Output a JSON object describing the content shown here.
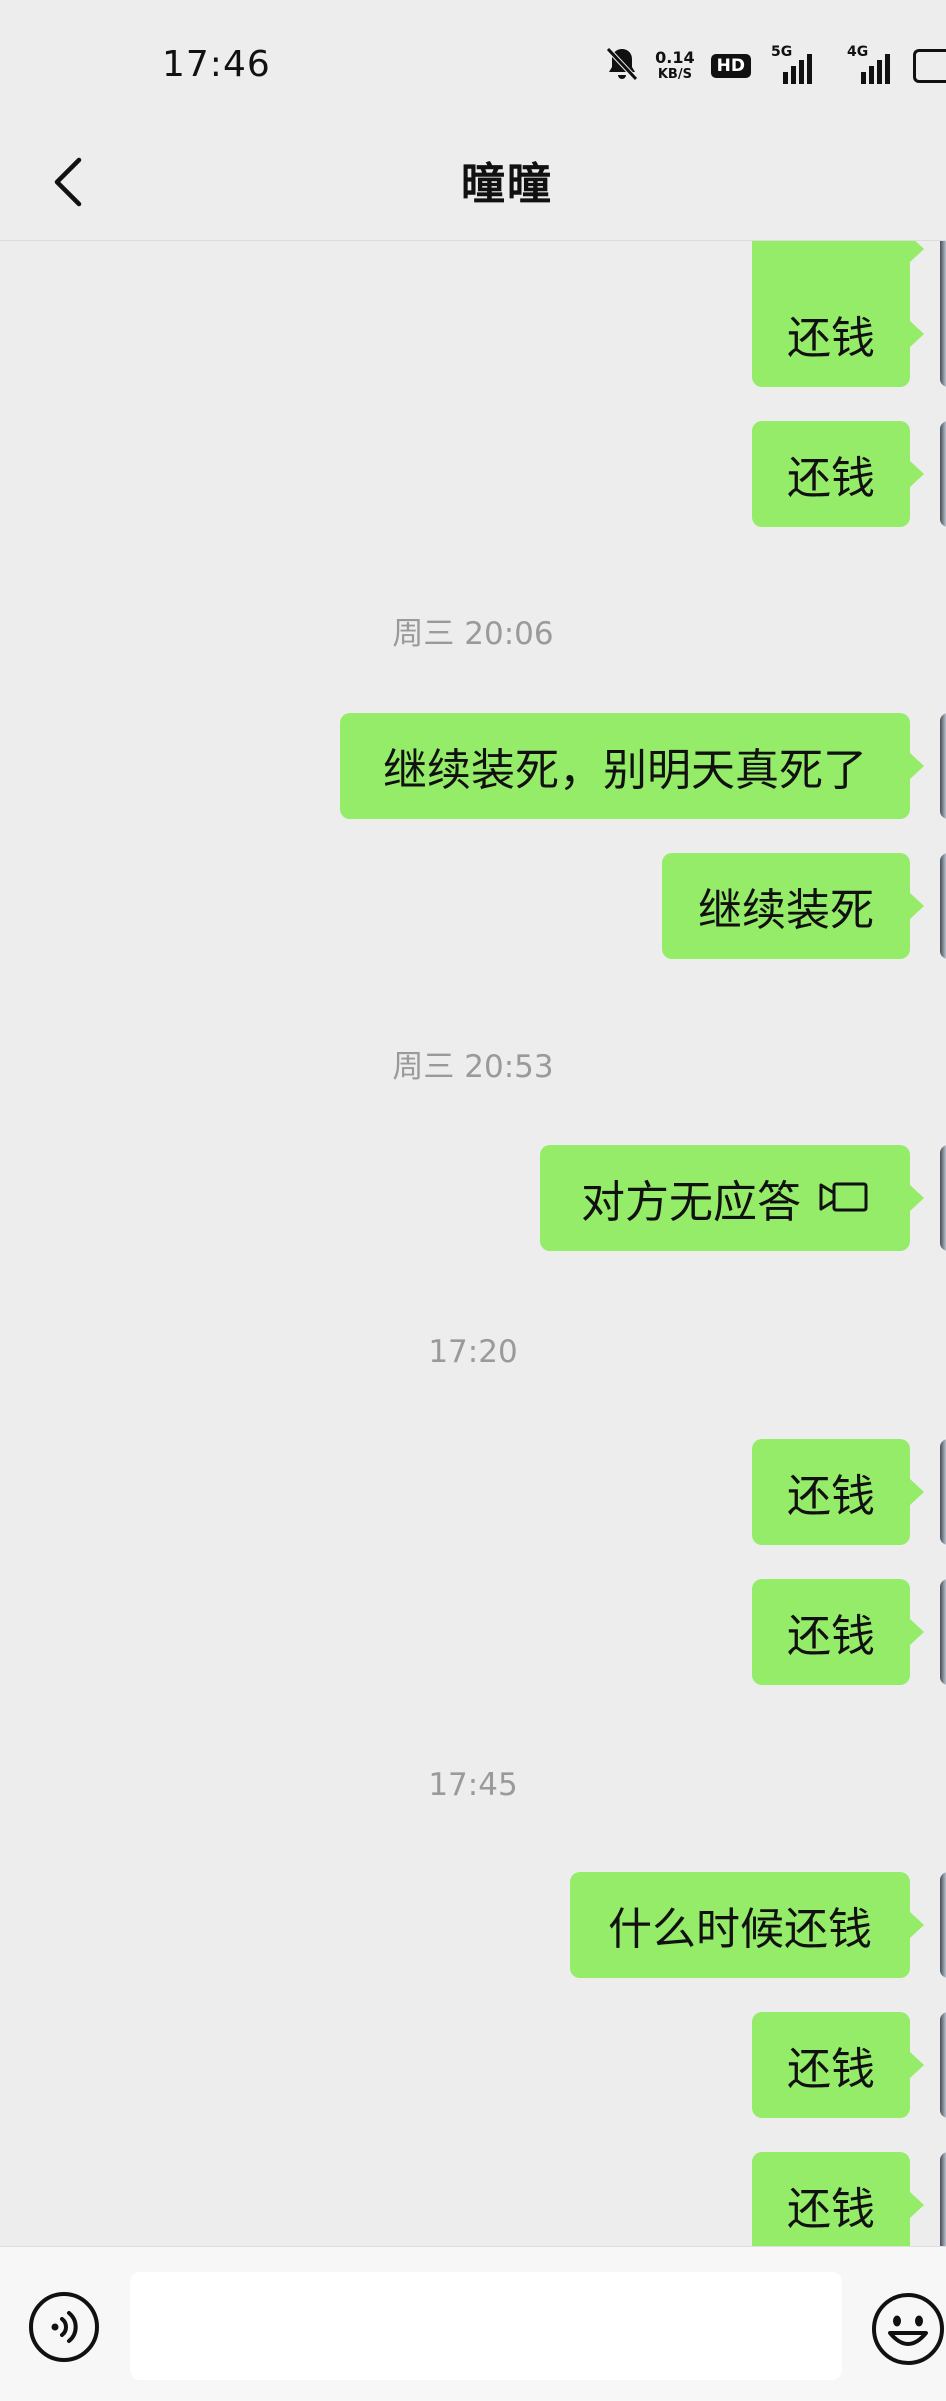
{
  "status_bar": {
    "time": "17:46",
    "speed_value": "0.14",
    "speed_unit": "KB/S",
    "hd_badge": "HD",
    "signal1_label": "5G",
    "signal2_label": "4G"
  },
  "header": {
    "title": "曈曈"
  },
  "messages": [
    {
      "type": "text",
      "text": "还钱"
    },
    {
      "type": "text",
      "text": "还钱"
    },
    {
      "type": "time",
      "text": "周三 20:06"
    },
    {
      "type": "text",
      "text": "继续装死，别明天真死了"
    },
    {
      "type": "text",
      "text": "继续装死"
    },
    {
      "type": "time",
      "text": "周三 20:53"
    },
    {
      "type": "call",
      "text": "对方无应答"
    },
    {
      "type": "time",
      "text": "17:20"
    },
    {
      "type": "text",
      "text": "还钱"
    },
    {
      "type": "text",
      "text": "还钱"
    },
    {
      "type": "time",
      "text": "17:45"
    },
    {
      "type": "text",
      "text": "什么时候还钱"
    },
    {
      "type": "text",
      "text": "还钱"
    },
    {
      "type": "text",
      "text": "还钱"
    }
  ],
  "input_bar": {
    "value": ""
  },
  "colors": {
    "background": "#ededed",
    "bubble": "#95ec69",
    "timestamp": "#9a9a9a"
  }
}
